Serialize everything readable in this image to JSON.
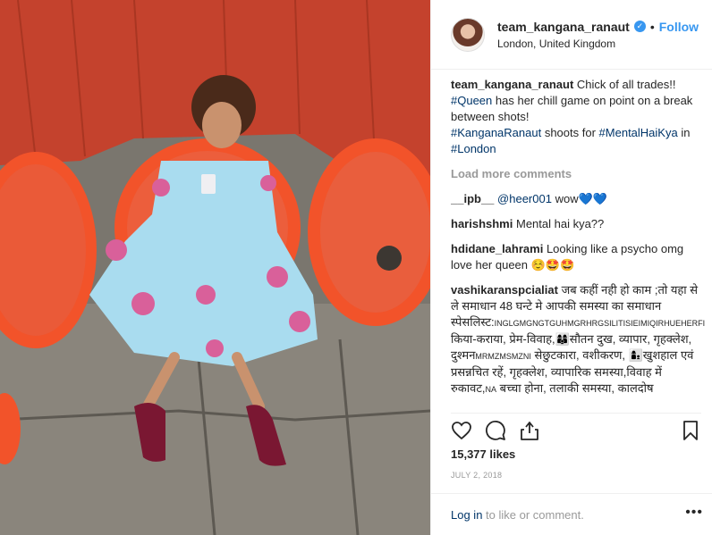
{
  "author": {
    "username": "team_kangana_ranaut",
    "location": "London, United Kingdom",
    "follow_label": "Follow",
    "separator": "•"
  },
  "caption": {
    "username": "team_kangana_ranaut",
    "line1": "Chick of all trades!!",
    "tag1": "#Queen",
    "line2": "has her chill game on point on a break between shots!",
    "tag2": "#KanganaRanaut",
    "line3": "shoots for",
    "tag3": "#MentalHaiKya",
    "line4": "in",
    "tag4": "#London"
  },
  "load_more": "Load more comments",
  "comments": [
    {
      "user": "__ipb__",
      "mention": "@heer001",
      "text": "wow💙💙"
    },
    {
      "user": "harishshmi",
      "text": "Mental hai kya??"
    },
    {
      "user": "hdidane_lahrami",
      "text": "Looking like a psycho omg love her queen ☺️🤩🤩"
    },
    {
      "user": "vashikaranspcialiat",
      "text": "जब कहीं नही हो काम ;तो यहा से ले समाधान 48 घन्टे मे आपकी समस्या का समाधान स्पेसलिस्ट:",
      "small1": "INGLGMGNGTGUHMGRHRGSILITISIEIMIQIRHUEHERFIMNMNMUMUMU",
      "text2": "किया-कराया, प्रेम-विवाह,👩‍👩‍👦सौतन दुख, व्यापार, गृहक्लेश, दुश्मन",
      "small2": "MRMZMSMZNI",
      "text3": "सेछुटकारा, वशीकरण, 👩‍👦खुशहाल एवं प्रसन्नचित रहें, गृहक्लेश, व्यापारिक समस्या,विवाह में रुकावट,",
      "small3": "NA",
      "text4": "बच्चा होना, तलाकी समस्या, कालदोष"
    }
  ],
  "likes": "15,377 likes",
  "date": "JULY 2, 2018",
  "footer": {
    "login": "Log in",
    "rest": "to like or comment.",
    "more": "•••"
  },
  "icons": [
    "heart-icon",
    "comment-icon",
    "share-icon",
    "bookmark-icon",
    "more-options-icon",
    "verified-badge-icon"
  ],
  "colors": {
    "link": "#3897f0",
    "hashtag": "#003569",
    "muted": "#999999",
    "chair": "#f04a1f",
    "wall": "#c9452f"
  }
}
